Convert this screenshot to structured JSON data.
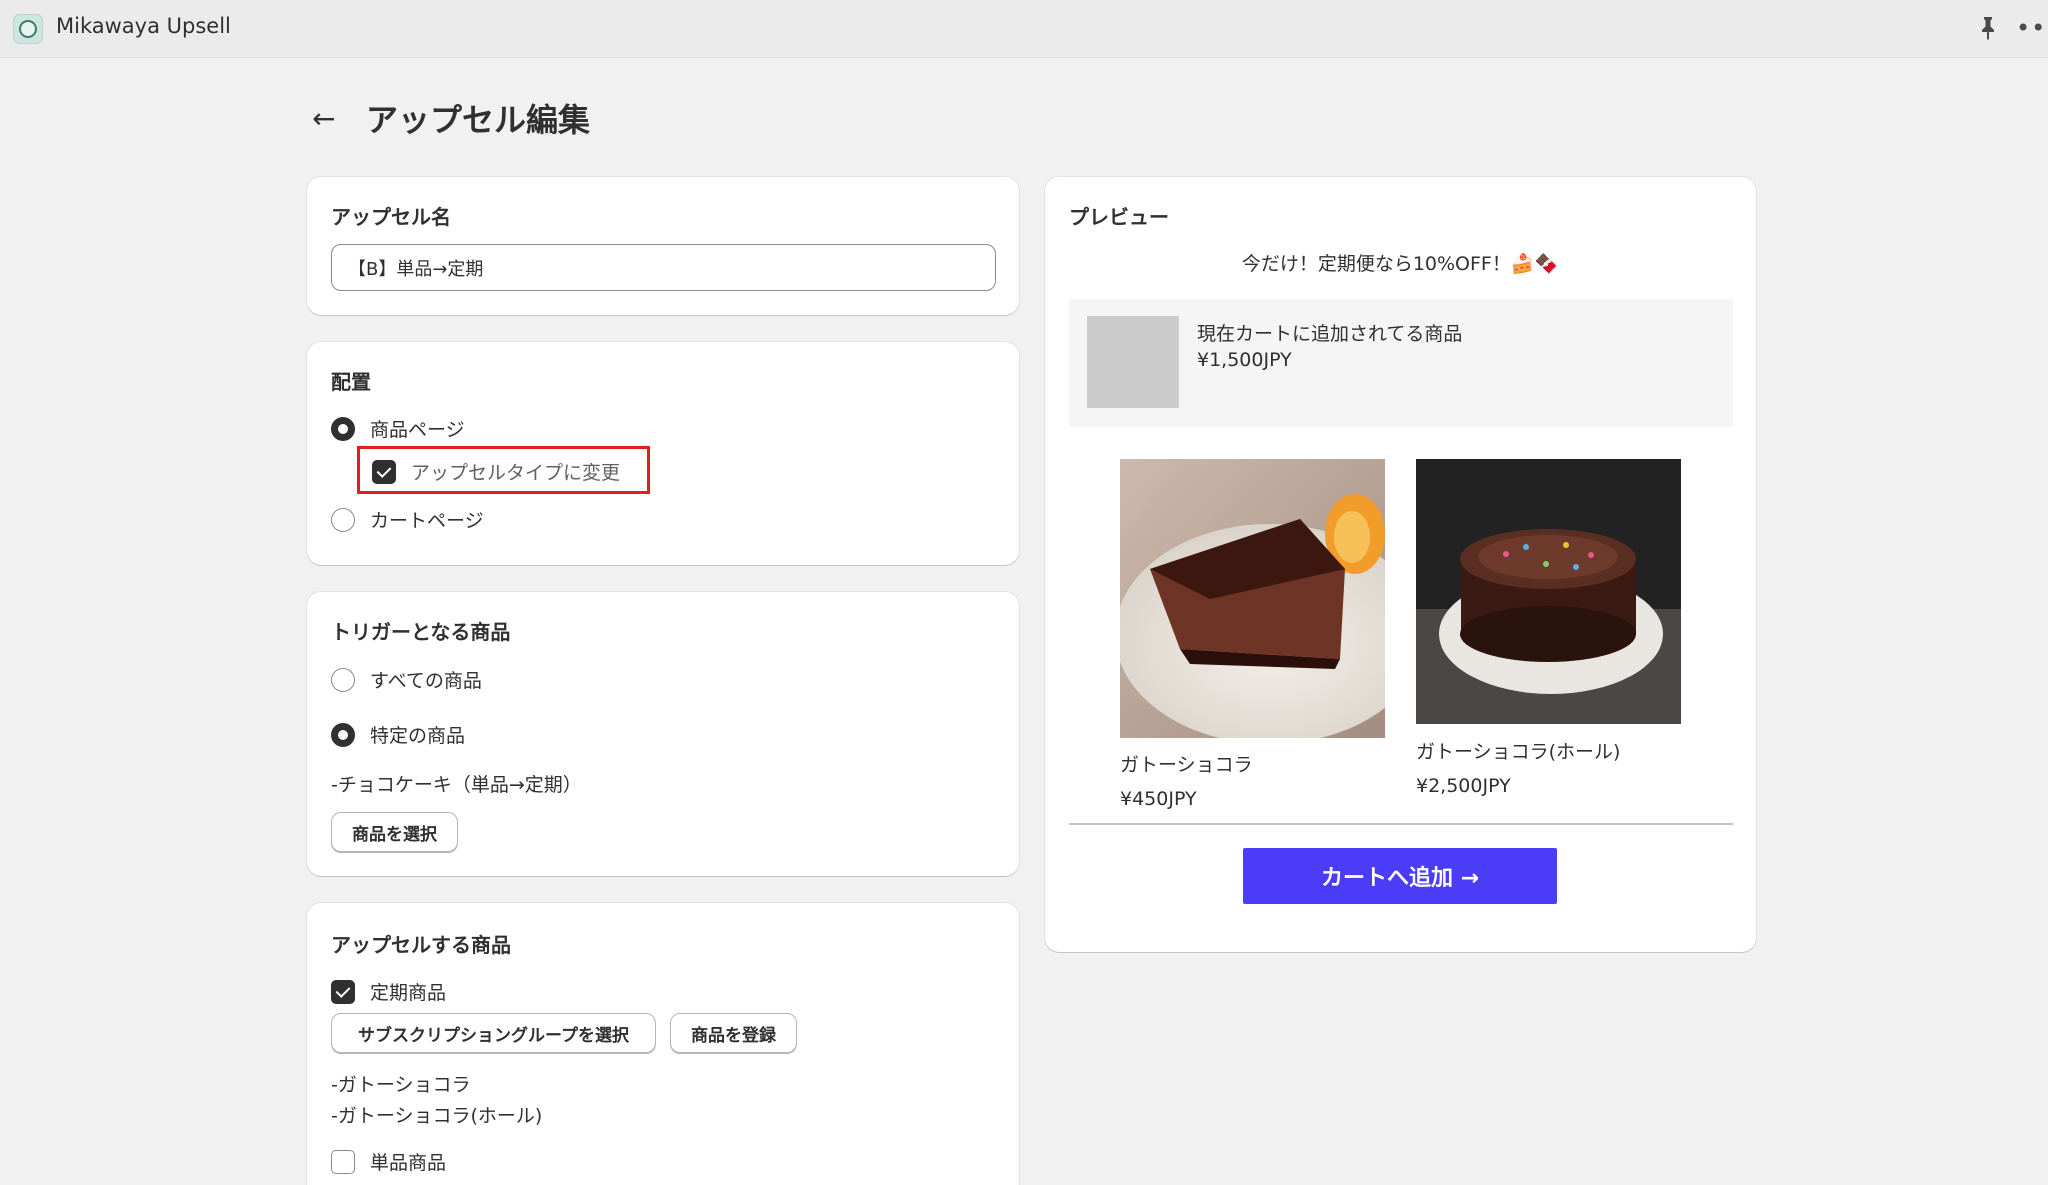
{
  "app": {
    "title": "Mikawaya Upsell"
  },
  "page": {
    "title": "アップセル編集"
  },
  "name_card": {
    "title": "アップセル名",
    "value": "【B】単品→定期"
  },
  "placement": {
    "title": "配置",
    "product_page": "商品ページ",
    "change_type": "アップセルタイプに変更",
    "cart_page": "カートページ"
  },
  "trigger": {
    "title": "トリガーとなる商品",
    "all": "すべての商品",
    "specific": "特定の商品",
    "selected": "-チョコケーキ（単品→定期）",
    "select_button": "商品を選択"
  },
  "upsell": {
    "title": "アップセルする商品",
    "subscription": "定期商品",
    "select_group_button": "サブスクリプショングループを選択",
    "register_button": "商品を登録",
    "products": [
      "-ガトーショコラ",
      "-ガトーショコラ(ホール)"
    ],
    "single": "単品商品"
  },
  "preview": {
    "title": "プレビュー",
    "banner": "今だけ！定期便なら10%OFF！🍰🍫",
    "cart_item_name": "現在カートに追加されてる商品",
    "cart_item_price": "¥1,500JPY",
    "products": [
      {
        "name": "ガトーショコラ",
        "price": "¥450JPY"
      },
      {
        "name": "ガトーショコラ(ホール)",
        "price": "¥2,500JPY"
      }
    ],
    "add_button": "カートへ追加 →"
  },
  "colors": {
    "accent": "#4a3cf7",
    "highlight": "#e0201b"
  }
}
